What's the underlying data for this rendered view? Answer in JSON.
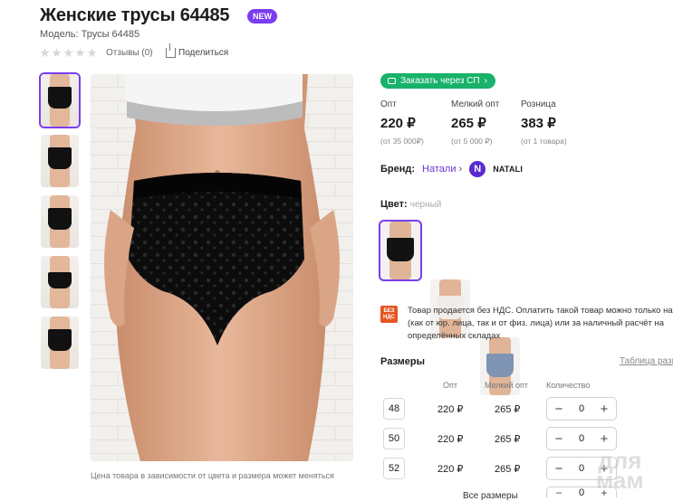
{
  "product": {
    "title": "Женские трусы 64485",
    "badge": "NEW",
    "model": "Модель: Трусы 64485",
    "reviews": "Отзывы (0)",
    "share": "Поделиться"
  },
  "gallery": {
    "thumbnail_count": 5,
    "caption": "Цена товара в зависимости от цвета и размера может меняться"
  },
  "order_button": "Заказать через СП",
  "prices": [
    {
      "label": "Опт",
      "value": "220 ₽",
      "note": "(от 35 000₽)"
    },
    {
      "label": "Мелкий опт",
      "value": "265 ₽",
      "note": "(от 5 000 ₽)"
    },
    {
      "label": "Розница",
      "value": "383 ₽",
      "note": "(от 1 товара)"
    }
  ],
  "brand": {
    "label": "Бренд:",
    "name": "Натали",
    "logo_letter": "N",
    "logo_text": "NATALI"
  },
  "color": {
    "label": "Цвет:",
    "selected": "черный",
    "swatches": [
      "#121212",
      "#f1ece8",
      "#7f94b3"
    ]
  },
  "vat": {
    "icon_line1": "БЕЗ",
    "icon_line2": "НДС",
    "line1": "Товар продается без НДС. Оплатить такой товар можно только на р",
    "line2": "(как от юр. лица, так и от физ. лица) или за наличный расчёт на",
    "line3": "определённых складах"
  },
  "sizes": {
    "title": "Размеры",
    "table_link": "Таблица разме",
    "headers": {
      "wholesale": "Опт",
      "small": "Мелкий опт",
      "qty": "Количество"
    },
    "rows": [
      {
        "size": "48",
        "opt": "220 ₽",
        "small": "265 ₽",
        "qty": "0"
      },
      {
        "size": "50",
        "opt": "220 ₽",
        "small": "265 ₽",
        "qty": "0"
      },
      {
        "size": "52",
        "opt": "220 ₽",
        "small": "265 ₽",
        "qty": "0"
      }
    ],
    "all_sizes": "Все размеры",
    "all_qty": "0"
  },
  "watermark": {
    "line1": "для",
    "line2": "мам"
  },
  "colors": {
    "accent": "#7a3df0",
    "green": "#19b26b",
    "vat": "#e5551f"
  }
}
